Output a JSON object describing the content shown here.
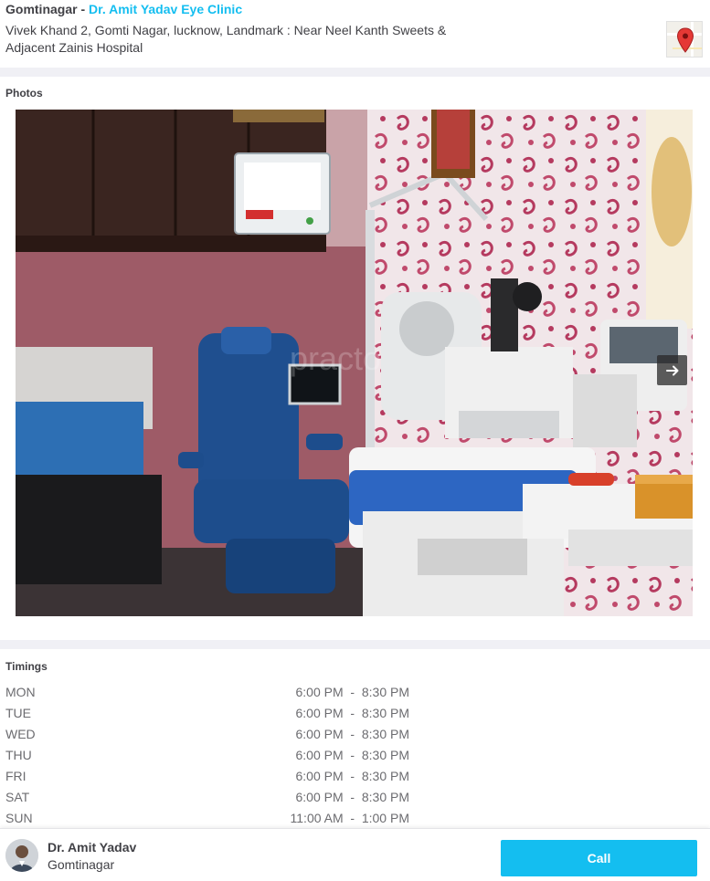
{
  "clinic": {
    "locality": "Gomtinagar",
    "separator": " - ",
    "name": "Dr. Amit Yadav Eye Clinic",
    "address": "Vivek Khand 2, Gomti Nagar, lucknow, Landmark : Near Neel Kanth Sweets & Adjacent Zainis Hospital",
    "map_icon": "map-pin-icon"
  },
  "photos": {
    "heading": "Photos",
    "next_icon": "arrow-right-icon"
  },
  "timings": {
    "heading": "Timings",
    "rows": [
      {
        "day": "MON",
        "time": "6:00 PM  -  8:30 PM"
      },
      {
        "day": "TUE",
        "time": "6:00 PM  -  8:30 PM"
      },
      {
        "day": "WED",
        "time": "6:00 PM  -  8:30 PM"
      },
      {
        "day": "THU",
        "time": "6:00 PM  -  8:30 PM"
      },
      {
        "day": "FRI",
        "time": "6:00 PM  -  8:30 PM"
      },
      {
        "day": "SAT",
        "time": "6:00 PM  -  8:30 PM"
      },
      {
        "day": "SUN",
        "time": "11:00 AM  -  1:00 PM"
      }
    ]
  },
  "footer": {
    "doctor_name": "Dr. Amit Yadav",
    "doctor_location": "Gomtinagar",
    "call_label": "Call"
  },
  "colors": {
    "accent": "#14bef0",
    "text": "#414146",
    "muted": "#6c6c70",
    "band": "#f0f0f5"
  }
}
